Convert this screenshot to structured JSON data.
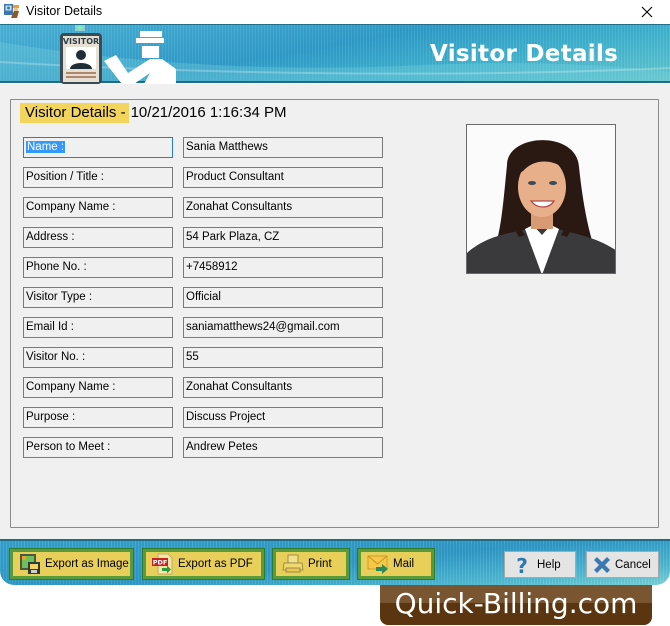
{
  "window": {
    "title": "Visitor Details",
    "app_icon": "visitor-app-icon",
    "close_icon": "close-icon"
  },
  "banner": {
    "title": "Visitor Details",
    "badge_text": "VISITOR",
    "icons": [
      "visitor-badge-icon",
      "security-guard-icon"
    ]
  },
  "group": {
    "legend_label": "Visitor Details -",
    "legend_date": "10/21/2016 1:16:34 PM"
  },
  "fields": [
    {
      "label": "Name :",
      "value": "Sania Matthews",
      "focused": true
    },
    {
      "label": "Position / Title :",
      "value": "Product Consultant"
    },
    {
      "label": "Company Name :",
      "value": "Zonahat Consultants"
    },
    {
      "label": "Address :",
      "value": "54 Park Plaza, CZ"
    },
    {
      "label": "Phone No. :",
      "value": "+7458912"
    },
    {
      "label": "Visitor Type :",
      "value": "Official"
    },
    {
      "label": "Email Id :",
      "value": "saniamatthews24@gmail.com"
    },
    {
      "label": "Visitor No. :",
      "value": "55"
    },
    {
      "label": "Company Name :",
      "value": "Zonahat Consultants"
    },
    {
      "label": "Purpose :",
      "value": "Discuss Project"
    },
    {
      "label": "Person to Meet :",
      "value": "Andrew Petes"
    }
  ],
  "photo": {
    "description": "visitor-photo"
  },
  "footer": {
    "buttons": [
      {
        "label": "Export as Image",
        "icon": "export-image-icon"
      },
      {
        "label": "Export as PDF",
        "icon": "pdf-icon"
      },
      {
        "label": "Print",
        "icon": "printer-icon"
      },
      {
        "label": "Mail",
        "icon": "mail-icon"
      },
      {
        "label": "Help",
        "icon": "help-icon"
      },
      {
        "label": "Cancel",
        "icon": "cancel-icon"
      }
    ]
  },
  "brand": {
    "text": "Quick-Billing.com"
  },
  "colors": {
    "banner_blue": "#2f9cc9",
    "legend_yellow": "#f3d45c",
    "button_yellow": "#e8cf5a",
    "button_border_green": "#5a9a3a",
    "brand_brown": "#5a3510",
    "focus_blue": "#3399ff"
  }
}
